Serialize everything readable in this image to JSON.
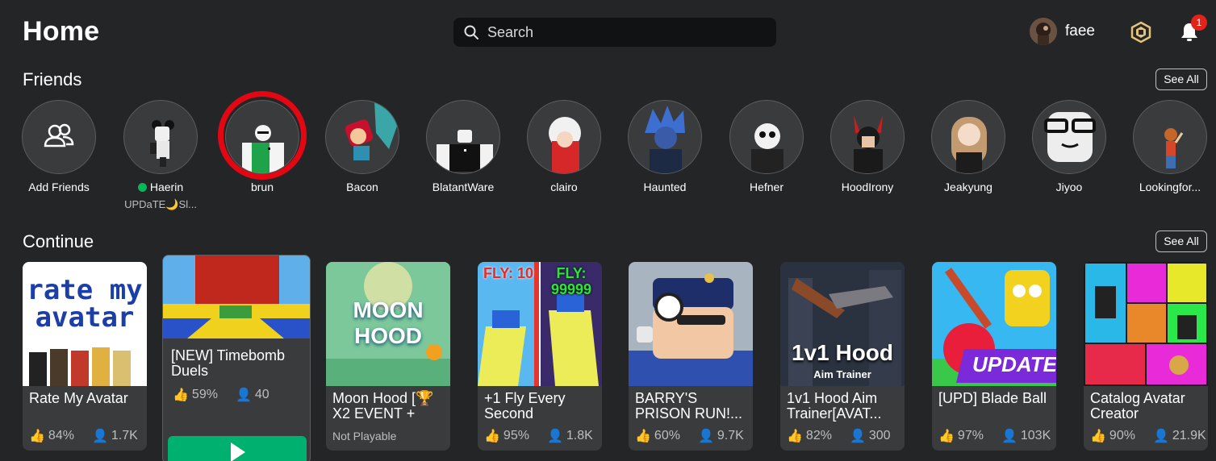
{
  "header": {
    "title": "Home",
    "search_placeholder": "Search",
    "username": "faee",
    "notification_count": "1"
  },
  "friends": {
    "title": "Friends",
    "see_all": "See All",
    "items": [
      {
        "name": "Add Friends",
        "status": ""
      },
      {
        "name": "Haerin",
        "status": "UPDaTE🌙Sl...",
        "online": true
      },
      {
        "name": "brun",
        "status": ""
      },
      {
        "name": "Bacon",
        "status": ""
      },
      {
        "name": "BlatantWare",
        "status": ""
      },
      {
        "name": "clairo",
        "status": ""
      },
      {
        "name": "Haunted",
        "status": ""
      },
      {
        "name": "Hefner",
        "status": ""
      },
      {
        "name": "HoodIrony",
        "status": ""
      },
      {
        "name": "Jeakyung",
        "status": ""
      },
      {
        "name": "Jiyoo",
        "status": ""
      },
      {
        "name": "Lookingfor...",
        "status": ""
      }
    ]
  },
  "continue": {
    "title": "Continue",
    "see_all": "See All",
    "games": [
      {
        "title": "Rate My Avatar",
        "rating": "84%",
        "players": "1.7K",
        "thumb_text": "rate my avatar"
      },
      {
        "title": "[NEW] Timebomb Duels",
        "rating": "59%",
        "players": "40"
      },
      {
        "title": "Moon Hood [🏆X2 EVENT +",
        "status": "Not Playable",
        "thumb_text": "MOON HOOD"
      },
      {
        "title": "+1 Fly Every Second",
        "rating": "95%",
        "players": "1.8K",
        "thumb_text_left": "FLY: 10",
        "thumb_text_right": "FLY: 99999"
      },
      {
        "title": "BARRY'S PRISON RUN!...",
        "rating": "60%",
        "players": "9.7K"
      },
      {
        "title": "1v1 Hood Aim Trainer[AVAT...",
        "rating": "82%",
        "players": "300",
        "thumb_text": "1v1 Hood",
        "thumb_subtext": "Aim Trainer"
      },
      {
        "title": "[UPD] Blade Ball",
        "rating": "97%",
        "players": "103K",
        "thumb_text": "UPDATE"
      },
      {
        "title": "Catalog Avatar Creator",
        "rating": "90%",
        "players": "21.9K"
      }
    ]
  },
  "colors": {
    "background": "#232527",
    "card": "#393b3d",
    "highlight": "#e30613",
    "play": "#00b06f",
    "online": "#02b757"
  }
}
